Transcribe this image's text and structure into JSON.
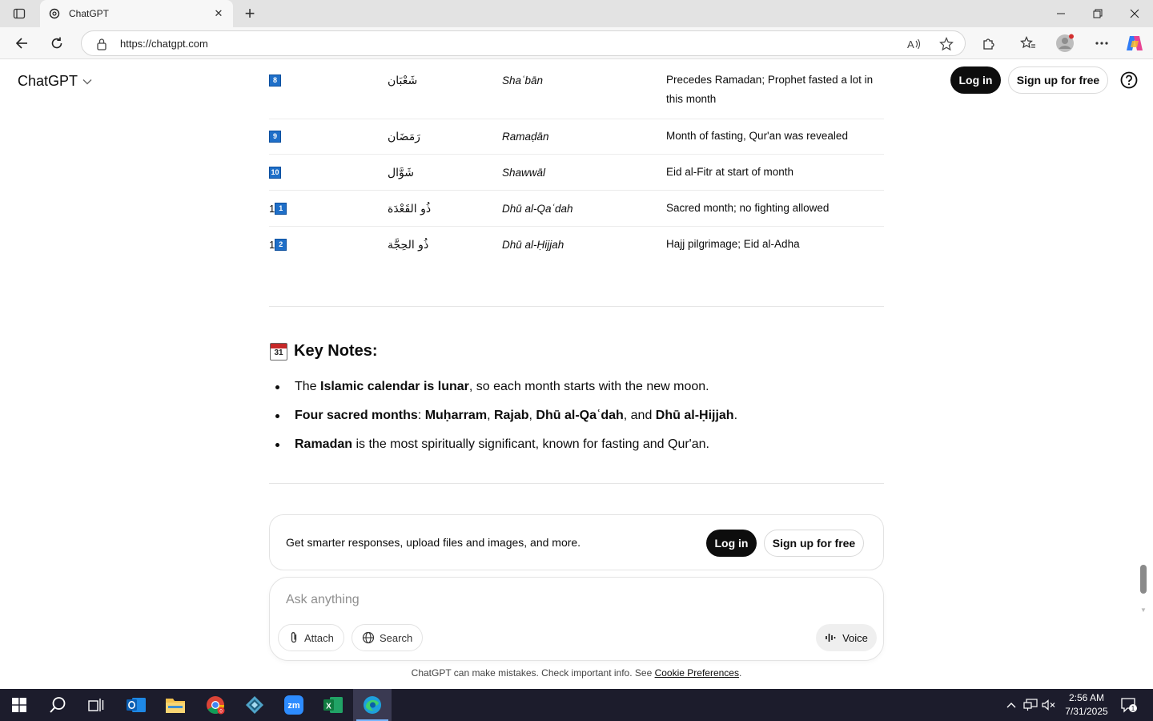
{
  "browser": {
    "tab_title": "ChatGPT",
    "url": "https://chatgpt.com"
  },
  "header": {
    "brand": "ChatGPT",
    "login_label": "Log in",
    "signup_label": "Sign up for free"
  },
  "months": [
    {
      "num_prefix": "",
      "num_box": "8",
      "arabic": "شَعْبَان",
      "translit": "Shaʿbān",
      "notes": "Precedes Ramadan; Prophet fasted a lot in this month"
    },
    {
      "num_prefix": "",
      "num_box": "9",
      "arabic": "رَمَضَان",
      "translit": "Ramaḍān",
      "notes": "Month of fasting, Qur'an was revealed"
    },
    {
      "num_prefix": "",
      "num_box": "10",
      "arabic": "شَوَّال",
      "translit": "Shawwāl",
      "notes": "Eid al-Fitr at start of month"
    },
    {
      "num_prefix": "1",
      "num_box": "1",
      "arabic": "ذُو القَعْدَة",
      "translit": "Dhū al-Qaʿdah",
      "notes": "Sacred month; no fighting allowed"
    },
    {
      "num_prefix": "1",
      "num_box": "2",
      "arabic": "ذُو الحِجَّة",
      "translit": "Dhū al-Ḥijjah",
      "notes": "Hajj pilgrimage; Eid al-Adha"
    }
  ],
  "key_notes": {
    "icon_day": "31",
    "heading": "Key Notes:",
    "b1": {
      "pre": "The ",
      "bold": "Islamic calendar is lunar",
      "post": ", so each month starts with the new moon."
    },
    "b2": {
      "bold1": "Four sacred months",
      "sep1": ": ",
      "bold2": "Muḥarram",
      "sep2": ", ",
      "bold3": "Rajab",
      "sep3": ", ",
      "bold4": "Dhū al-Qaʿdah",
      "sep4": ", and ",
      "bold5": "Dhū al-Ḥijjah",
      "end": "."
    },
    "b3": {
      "bold": "Ramadan",
      "post": " is the most spiritually significant, known for fasting and Qur'an."
    }
  },
  "promo": {
    "text": "Get smarter responses, upload files and images, and more.",
    "login_label": "Log in",
    "signup_label": "Sign up for free"
  },
  "composer": {
    "placeholder": "Ask anything",
    "attach_label": "Attach",
    "search_label": "Search",
    "voice_label": "Voice"
  },
  "disclaimer": {
    "text": "ChatGPT can make mistakes. Check important info. See ",
    "link": "Cookie Preferences",
    "end": "."
  },
  "taskbar": {
    "time": "2:56 AM",
    "date": "7/31/2025",
    "notification_count": "1"
  },
  "colors": {
    "accent_dark": "#0d0d0d",
    "keycap_blue": "#1f6fc8",
    "taskbar_bg": "#1c1c2c"
  }
}
